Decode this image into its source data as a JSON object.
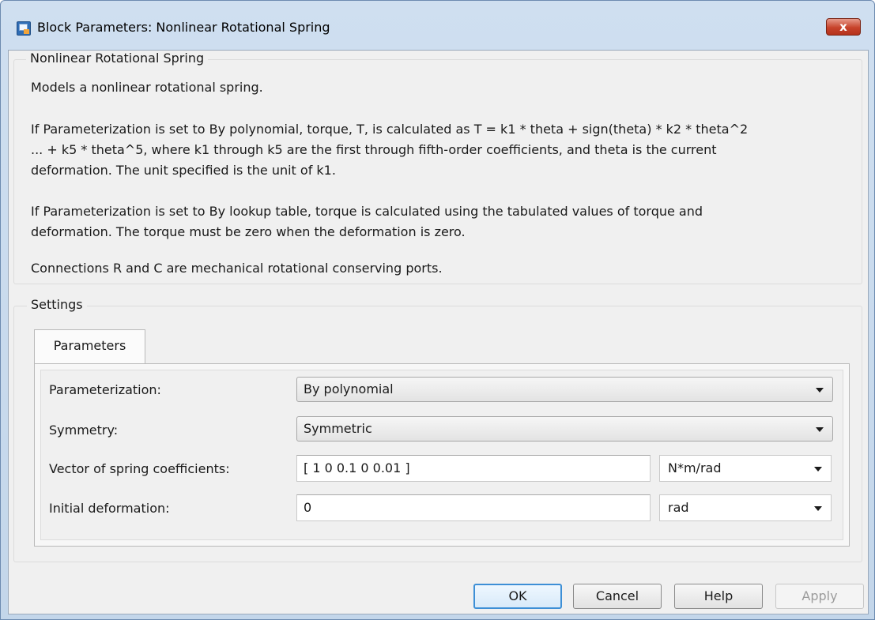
{
  "window": {
    "title": "Block Parameters: Nonlinear Rotational Spring",
    "close_label": "x"
  },
  "description_group": {
    "title": "Nonlinear Rotational Spring",
    "lines": [
      "Models a nonlinear rotational spring.",
      "If Parameterization is set to By polynomial, torque, T, is calculated as T = k1 * theta + sign(theta) * k2 * theta^2",
      "... + k5 * theta^5, where k1 through k5 are the first through fifth-order coefficients, and theta is the current",
      "deformation. The unit specified is the unit of k1.",
      "If Parameterization is set to By lookup table, torque is calculated using the tabulated values of torque and",
      "deformation. The torque must be zero when the deformation is zero.",
      "Connections R and C are mechanical rotational conserving ports."
    ]
  },
  "settings_group": {
    "title": "Settings",
    "tab_label": "Parameters",
    "rows": [
      {
        "label": "Parameterization:",
        "value": "By polynomial"
      },
      {
        "label": "Symmetry:",
        "value": "Symmetric"
      },
      {
        "label": "Vector of spring coefficients:",
        "value": "[ 1 0 0.1 0 0.01 ]",
        "unit": "N*m/rad"
      },
      {
        "label": "Initial deformation:",
        "value": "0",
        "unit": "rad"
      }
    ]
  },
  "buttons": {
    "ok": "OK",
    "cancel": "Cancel",
    "help": "Help",
    "apply": "Apply"
  }
}
